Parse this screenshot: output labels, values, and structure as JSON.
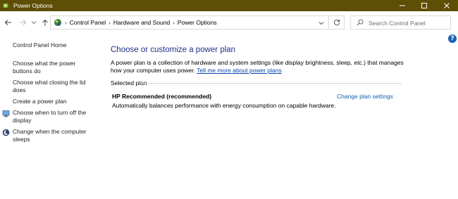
{
  "window": {
    "title": "Power Options",
    "controls": {
      "minimize": "—",
      "maximize": "☐",
      "close": "✕"
    }
  },
  "nav": {
    "back": "←",
    "forward": "→",
    "recent": "⌄",
    "up": "↑"
  },
  "address": {
    "breadcrumbs": [
      "Control Panel",
      "Hardware and Sound",
      "Power Options"
    ],
    "separator": "›"
  },
  "search": {
    "placeholder": "Search Control Panel"
  },
  "help": {
    "label": "?"
  },
  "sidebar": {
    "items": [
      {
        "label": "Control Panel Home"
      },
      {
        "label": "Choose what the power buttons do"
      },
      {
        "label": "Choose what closing the lid does"
      },
      {
        "label": "Create a power plan"
      },
      {
        "label": "Choose when to turn off the display"
      },
      {
        "label": "Change when the computer sleeps"
      }
    ]
  },
  "main": {
    "heading": "Choose or customize a power plan",
    "description": "A power plan is a collection of hardware and system settings (like display brightness, sleep, etc.) that manages how your computer uses power.",
    "more_link": "Tell me more about power plans",
    "selected_plan_label": "Selected plan",
    "plan": {
      "name": "HP Recommended (recommended)",
      "change_link": "Change plan settings",
      "description": "Automatically balances performance with energy consumption on capable hardware."
    }
  },
  "colors": {
    "titlebar": "#5e4e06",
    "heading": "#1e3287",
    "link": "#0f5fb4",
    "help": "#1c64b5"
  }
}
